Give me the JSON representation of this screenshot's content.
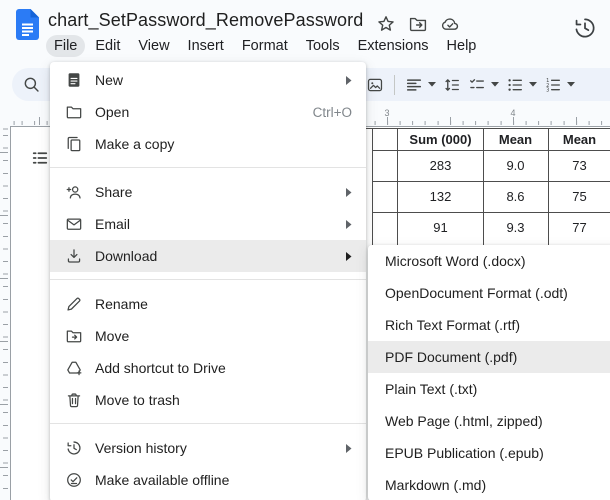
{
  "titlebar": {
    "title": "chart_SetPassword_RemovePassword"
  },
  "menubar": {
    "items": [
      {
        "label": "File",
        "active": true
      },
      {
        "label": "Edit"
      },
      {
        "label": "View"
      },
      {
        "label": "Insert"
      },
      {
        "label": "Format"
      },
      {
        "label": "Tools"
      },
      {
        "label": "Extensions"
      },
      {
        "label": "Help"
      }
    ]
  },
  "file_menu": {
    "items": [
      {
        "label": "New",
        "has_submenu": true
      },
      {
        "label": "Open",
        "shortcut": "Ctrl+O"
      },
      {
        "label": "Make a copy"
      },
      {
        "label": "Share",
        "has_submenu": true
      },
      {
        "label": "Email",
        "has_submenu": true
      },
      {
        "label": "Download",
        "has_submenu": true,
        "highlighted": true
      },
      {
        "label": "Rename"
      },
      {
        "label": "Move"
      },
      {
        "label": "Add shortcut to Drive"
      },
      {
        "label": "Move to trash"
      },
      {
        "label": "Version history",
        "has_submenu": true
      },
      {
        "label": "Make available offline"
      }
    ]
  },
  "download_submenu": {
    "items": [
      {
        "label": "Microsoft Word (.docx)"
      },
      {
        "label": "OpenDocument Format (.odt)"
      },
      {
        "label": "Rich Text Format (.rtf)"
      },
      {
        "label": "PDF Document (.pdf)",
        "highlighted": true
      },
      {
        "label": "Plain Text (.txt)"
      },
      {
        "label": "Web Page (.html, zipped)"
      },
      {
        "label": "EPUB Publication (.epub)"
      },
      {
        "label": "Markdown (.md)"
      }
    ]
  },
  "ruler": {
    "numbers": [
      "3",
      "4"
    ]
  },
  "document_table": {
    "headers": [
      "Sum (000)",
      "Mean",
      "Mean"
    ],
    "rows": [
      [
        "283",
        "9.0",
        "73"
      ],
      [
        "132",
        "8.6",
        "75"
      ],
      [
        "91",
        "9.3",
        "77"
      ]
    ]
  },
  "colors": {
    "logo_blue": "#2b7bf5",
    "logo_fold": "#1664d8",
    "toolbar_bg": "#edf2fa",
    "menu_highlight": "#ebebeb",
    "menubar_active_bg": "#e3e6e9",
    "table_border": "#4d4d4d"
  }
}
